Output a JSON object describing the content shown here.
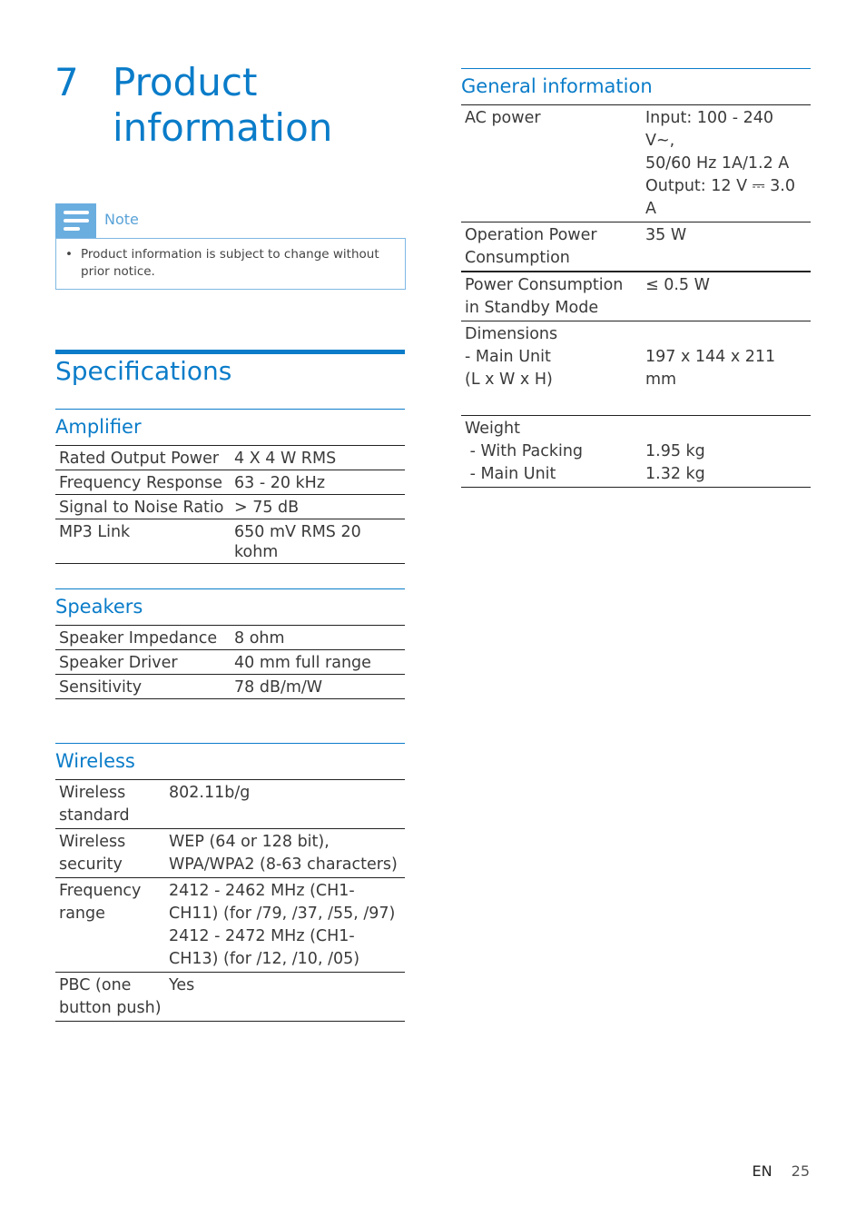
{
  "chapter": {
    "number": "7",
    "title": "Product information"
  },
  "note": {
    "icon": "note-lines-icon",
    "label": "Note",
    "items": [
      "Product information is subject to change without prior notice."
    ]
  },
  "specifications": {
    "title": "Specifications",
    "amplifier": {
      "title": "Amplifier",
      "rows": [
        {
          "label": "Rated Output Power",
          "value": "4 X 4 W RMS"
        },
        {
          "label": "Frequency Response",
          "value": "63 - 20 kHz"
        },
        {
          "label": "Signal to Noise Ratio",
          "value": "> 75 dB"
        },
        {
          "label": "MP3 Link",
          "value": "650 mV RMS 20 kohm"
        }
      ]
    },
    "speakers": {
      "title": "Speakers",
      "rows": [
        {
          "label": "Speaker Impedance",
          "value": "8 ohm"
        },
        {
          "label": "Speaker Driver",
          "value": "40 mm full range"
        },
        {
          "label": "Sensitivity",
          "value": "78 dB/m/W"
        }
      ]
    },
    "wireless": {
      "title": "Wireless",
      "rows": [
        {
          "label": "Wireless standard",
          "value": "802.11b/g"
        },
        {
          "label": "Wireless security",
          "value": "WEP (64 or 128 bit), WPA/WPA2 (8-63 characters)"
        },
        {
          "label": "Frequency range",
          "value": "2412 - 2462 MHz (CH1-CH11) (for /79, /37, /55, /97) 2412 - 2472 MHz (CH1-CH13) (for /12, /10, /05)"
        },
        {
          "label": "PBC (one button push)",
          "value": "Yes"
        }
      ]
    }
  },
  "general": {
    "title": "General information",
    "rows": [
      {
        "label": "AC power",
        "value_lines": [
          "Input: 100 - 240 V~,",
          "50/60 Hz 1A/1.2 A",
          "Output: 12 V ⎓ 3.0 A"
        ]
      },
      {
        "label": "Operation Power Consumption",
        "value_lines": [
          "35 W"
        ]
      },
      {
        "label": "Power Consumption in Standby Mode",
        "value_lines": [
          "≤ 0.5 W"
        ]
      },
      {
        "label_lines": [
          "Dimensions",
          "- Main Unit",
          "(L x W x H)"
        ],
        "value_lines": [
          "",
          "197 x 144 x 211 mm",
          ""
        ]
      },
      {
        "label_lines": [
          "Weight",
          " - With Packing",
          " - Main Unit"
        ],
        "value_lines": [
          "",
          "1.95 kg",
          "1.32 kg"
        ]
      }
    ]
  },
  "footer": {
    "language": "EN",
    "page": "25"
  }
}
